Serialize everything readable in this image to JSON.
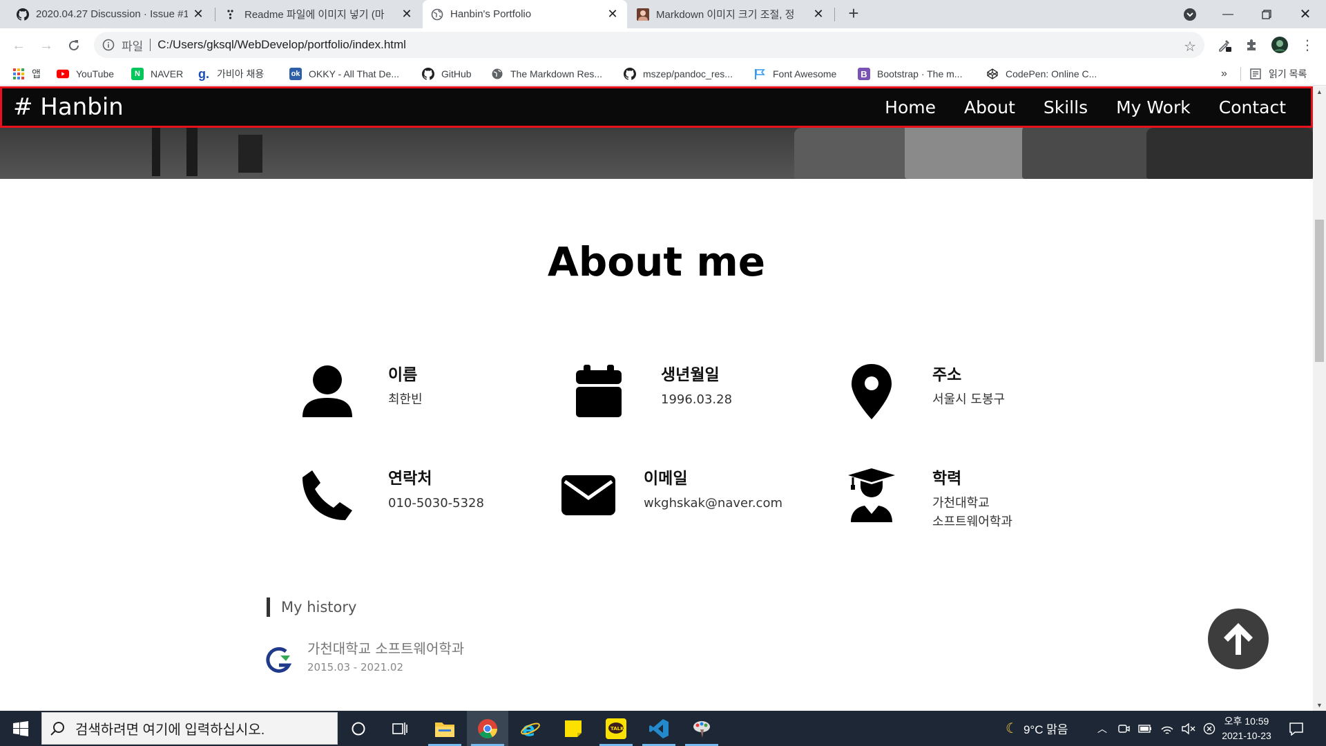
{
  "browser": {
    "tabs": [
      {
        "title": "2020.04.27 Discussion · Issue #1",
        "icon": "github-icon",
        "active": false
      },
      {
        "title": "Readme 파일에 이미지 넣기 (마",
        "icon": "velog-icon",
        "active": false
      },
      {
        "title": "Hanbin's Portfolio",
        "icon": "globe-icon",
        "active": true
      },
      {
        "title": "Markdown 이미지 크기 조절, 정",
        "icon": "avatar-icon",
        "active": false
      }
    ],
    "omnibox": {
      "scheme_label": "파일",
      "url": "C:/Users/gksql/WebDevelop/portfolio/index.html"
    },
    "bookmarks": [
      {
        "label": "앱",
        "icon": "apps-grid-icon",
        "color": "#ea4335"
      },
      {
        "label": "YouTube",
        "icon": "youtube-icon",
        "color": "#ff0000"
      },
      {
        "label": "NAVER",
        "icon": "naver-icon",
        "color": "#03c75a"
      },
      {
        "label": "가비아 채용",
        "icon": "gabia-icon",
        "color": "#1a4cb8"
      },
      {
        "label": "OKKY - All That De...",
        "icon": "okky-icon",
        "color": "#2d5ea8"
      },
      {
        "label": "GitHub",
        "icon": "github-icon",
        "color": "#000000"
      },
      {
        "label": "The Markdown Res...",
        "icon": "globe-icon",
        "color": "#5f6368"
      },
      {
        "label": "mszep/pandoc_res...",
        "icon": "github-icon",
        "color": "#000000"
      },
      {
        "label": "Font Awesome",
        "icon": "flag-icon",
        "color": "#339af0"
      },
      {
        "label": "Bootstrap · The m...",
        "icon": "bootstrap-icon",
        "color": "#7952b3"
      },
      {
        "label": "CodePen: Online C...",
        "icon": "codepen-icon",
        "color": "#000000"
      }
    ],
    "bookmarks_overflow": "»",
    "reading_list": "읽기 목록"
  },
  "site": {
    "brand": "# Hanbin",
    "nav": [
      "Home",
      "About",
      "Skills",
      "My Work",
      "Contact"
    ],
    "about_title": "About me",
    "info": [
      {
        "label": "이름",
        "value": "최한빈",
        "icon": "user-icon"
      },
      {
        "label": "생년월일",
        "value": "1996.03.28",
        "icon": "calendar-icon"
      },
      {
        "label": "주소",
        "value": "서울시 도봉구",
        "icon": "map-marker-icon"
      },
      {
        "label": "연락처",
        "value": "010-5030-5328",
        "icon": "phone-icon"
      },
      {
        "label": "이메일",
        "value": "wkghskak@naver.com",
        "icon": "envelope-icon"
      },
      {
        "label": "학력",
        "value": "가천대학교\n소프트웨어학과",
        "icon": "graduate-icon"
      }
    ],
    "history": {
      "heading": "My history",
      "school": "가천대학교 소프트웨어학과",
      "period": "2015.03 - 2021.02"
    },
    "to_top_icon": "arrow-up-icon"
  },
  "taskbar": {
    "search_placeholder": "검색하려면 여기에 입력하십시오.",
    "weather": "9°C  맑음",
    "time": "오후 10:59",
    "date": "2021-10-23",
    "apps": [
      "cortana-icon",
      "task-view-icon",
      "file-explorer-icon",
      "chrome-icon",
      "ie-icon",
      "sticky-notes-icon",
      "kakaotalk-icon",
      "vscode-icon",
      "paint-icon"
    ]
  }
}
